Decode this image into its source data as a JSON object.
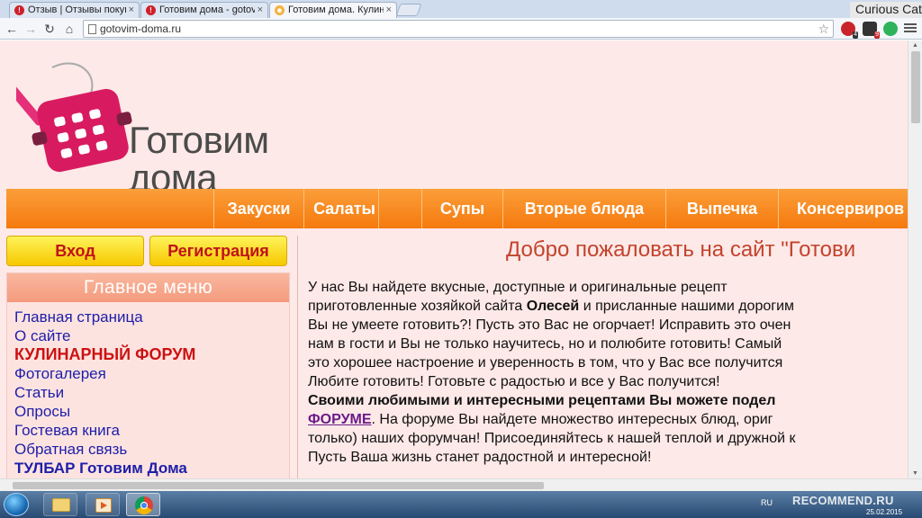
{
  "browser": {
    "tabs": [
      {
        "label": "Отзыв | Отзывы покупате",
        "favicon": "otzovik-icon",
        "active": false
      },
      {
        "label": "Готовим дома - gotovim",
        "favicon": "otzovik-icon",
        "active": false
      },
      {
        "label": "Готовим дома. Кулинарн",
        "favicon": "food-icon",
        "active": true
      }
    ],
    "profile_name": "Curious Cat",
    "url": "gotovim-doma.ru",
    "extensions": [
      {
        "name": "extension-red-icon",
        "badge": "4"
      },
      {
        "name": "extension-dark-icon",
        "badge": "9"
      },
      {
        "name": "extension-green-icon",
        "badge": ""
      }
    ]
  },
  "site": {
    "logo_line1": "Готовим",
    "logo_line2": "дома",
    "nav": [
      "Закуски",
      "Салаты",
      "Супы",
      "Вторые блюда",
      "Выпечка",
      "Консервиров"
    ],
    "login_label": "Вход",
    "register_label": "Регистрация",
    "menu": {
      "title": "Главное меню",
      "items": [
        {
          "label": "Главная страница",
          "style": "normal"
        },
        {
          "label": "О сайте",
          "style": "normal"
        },
        {
          "label": "КУЛИНАРНЫЙ ФОРУМ",
          "style": "red"
        },
        {
          "label": "Фотогалерея",
          "style": "normal"
        },
        {
          "label": "Статьи",
          "style": "normal"
        },
        {
          "label": "Опросы",
          "style": "normal"
        },
        {
          "label": "Гостевая книга",
          "style": "normal"
        },
        {
          "label": "Обратная связь",
          "style": "normal"
        },
        {
          "label": "ТУЛБАР Готовим Дома",
          "style": "bold"
        }
      ]
    },
    "welcome": "Добро пожаловать на сайт \"Готови",
    "body": {
      "p1": "У  нас  Вы  найдете  вкусные,  доступные  и  оригинальные  рецепт",
      "p2a": "приготовленные хозяйкой сайта ",
      "p2b": "Олесей",
      "p2c": " и присланные нашими дорогим",
      "p3": "Вы не умеете готовить?! Пусть это Вас не огорчает! Исправить это очен",
      "p4": "нам в гости и Вы не только научитесь, но и полюбите готовить! Самый",
      "p5": "это хорошее настроение и уверенность в том, что у Вас все получится",
      "p6": "Любите готовить! Готовьте с радостью и все у Вас получится!",
      "p7": "Своими любимыми и интересными рецептами Вы можете подел",
      "p8a": "ФОРУМЕ",
      "p8b": ". На форуме Вы найдете множество интересных блюд, ориг",
      "p9": "только) наших форумчан! Присоединяйтесь к нашей теплой и дружной к",
      "p10": "Пусть Ваша жизнь станет радостной и интересной!"
    }
  },
  "taskbar": {
    "apps": [
      "explorer-icon",
      "media-player-icon",
      "chrome-icon"
    ],
    "lang": "RU",
    "date": "25.02.2015",
    "watermark": "RECOMMEND.RU"
  },
  "colors": {
    "page_bg": "#fde9e7",
    "nav_orange": "#f57a0d",
    "title_red": "#c2432c",
    "link_blue": "#1e1ea8",
    "logo_pink": "#d81b60"
  }
}
